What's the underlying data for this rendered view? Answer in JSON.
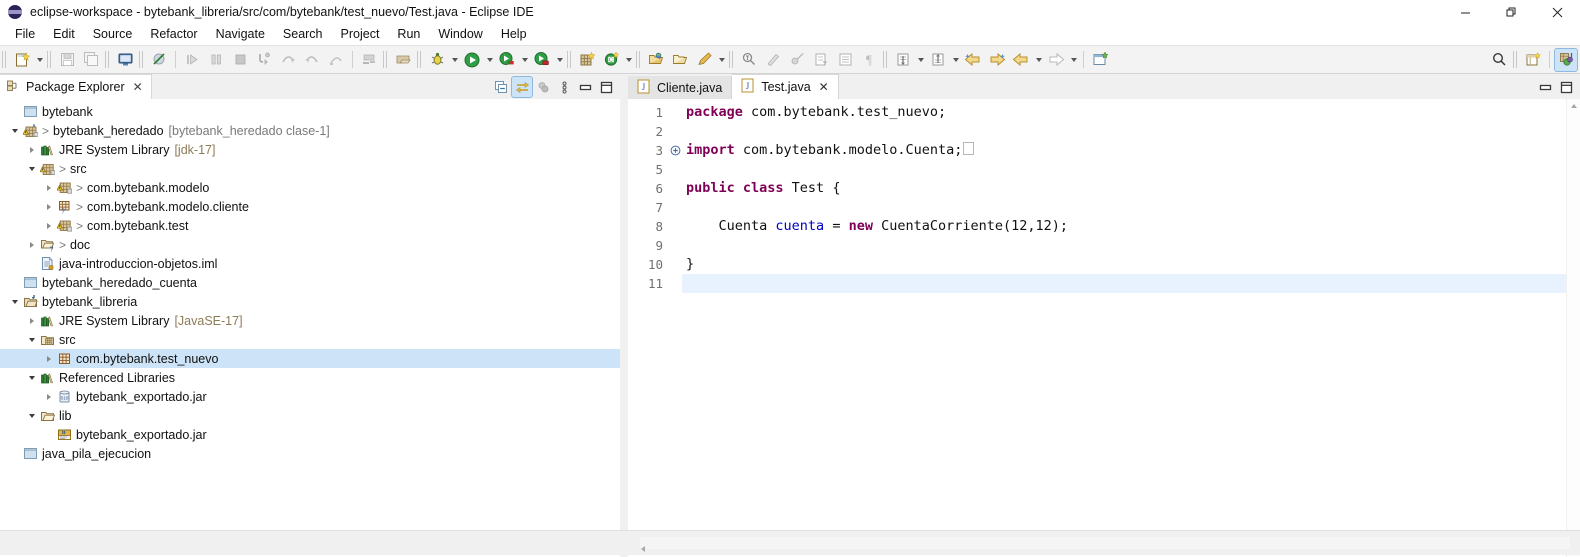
{
  "window": {
    "title": "eclipse-workspace - bytebank_libreria/src/com/bytebank/test_nuevo/Test.java - Eclipse IDE",
    "logo_icon": "eclipse-logo",
    "minimize": "—",
    "restore": "❐",
    "close": "✕"
  },
  "menu": {
    "items": [
      {
        "label": "File"
      },
      {
        "label": "Edit"
      },
      {
        "label": "Source"
      },
      {
        "label": "Refactor"
      },
      {
        "label": "Navigate"
      },
      {
        "label": "Search"
      },
      {
        "label": "Project"
      },
      {
        "label": "Run"
      },
      {
        "label": "Window"
      },
      {
        "label": "Help"
      }
    ]
  },
  "toolbar": {
    "items": [
      {
        "name": "new-wizard-icon",
        "enabled": true
      },
      {
        "name": "new-wizard-dropdown-icon",
        "enabled": true
      },
      {
        "name": "save-icon",
        "enabled": false
      },
      {
        "name": "save-all-icon",
        "enabled": false
      },
      {
        "name": "console-icon",
        "enabled": true
      },
      {
        "name": "skip-breakpoints-icon",
        "enabled": true
      },
      {
        "name": "resume-icon",
        "enabled": false
      },
      {
        "name": "suspend-icon",
        "enabled": false
      },
      {
        "name": "terminate-icon",
        "enabled": false
      },
      {
        "name": "step-into-icon",
        "enabled": false
      },
      {
        "name": "step-over-icon",
        "enabled": false
      },
      {
        "name": "step-return-icon",
        "enabled": false
      },
      {
        "name": "drop-to-frame-icon",
        "enabled": false
      },
      {
        "name": "open-task-icon",
        "enabled": true
      },
      {
        "name": "open-type-icon",
        "enabled": true
      },
      {
        "name": "debug-icon",
        "enabled": true
      },
      {
        "name": "run-icon",
        "enabled": true
      },
      {
        "name": "run-configurations-icon",
        "enabled": true
      },
      {
        "name": "coverage-icon",
        "enabled": true
      },
      {
        "name": "new-java-project-icon",
        "enabled": true
      },
      {
        "name": "new-java-class-icon",
        "enabled": true
      },
      {
        "name": "open-perspective-icon",
        "enabled": true
      },
      {
        "name": "search-folder-icon",
        "enabled": true
      },
      {
        "name": "annotation-icon",
        "enabled": true
      },
      {
        "name": "toggle-mark-occurrences-icon",
        "enabled": true
      },
      {
        "name": "pencil-icon",
        "enabled": false
      },
      {
        "name": "link-icon",
        "enabled": false
      },
      {
        "name": "show-whitespace-icon",
        "enabled": false
      },
      {
        "name": "block-selection-icon",
        "enabled": false
      },
      {
        "name": "paragraph-icon",
        "enabled": false
      },
      {
        "name": "previous-annotation-icon",
        "enabled": true
      },
      {
        "name": "next-annotation-icon",
        "enabled": true
      },
      {
        "name": "back-icon",
        "enabled": true
      },
      {
        "name": "forward-icon",
        "enabled": true
      },
      {
        "name": "last-edit-icon",
        "enabled": true
      },
      {
        "name": "next-edit-icon",
        "enabled": true
      },
      {
        "name": "new-window-icon",
        "enabled": true
      }
    ],
    "right_items": [
      {
        "name": "search-icon"
      },
      {
        "name": "open-perspective-button-icon"
      },
      {
        "name": "java-perspective-icon",
        "active": true
      }
    ]
  },
  "explorer": {
    "tab_label": "Package Explorer",
    "tab_icon": "package-explorer-icon",
    "tab_close": "✕",
    "tools": [
      {
        "name": "collapse-all-icon",
        "active": false
      },
      {
        "name": "link-with-editor-icon",
        "active": true
      },
      {
        "name": "focus-on-active-task-icon",
        "active": false
      },
      {
        "name": "view-menu-icon",
        "active": false
      },
      {
        "name": "minimize-view-icon",
        "active": false
      },
      {
        "name": "maximize-view-icon",
        "active": false
      }
    ],
    "tree": [
      {
        "depth": 0,
        "twisty": "none",
        "icon": "closed-project-icon",
        "chevron": false,
        "label": "bytebank",
        "suffix": ""
      },
      {
        "depth": 0,
        "twisty": "open",
        "icon": "java-project-warn-icon",
        "chevron": true,
        "label": "bytebank_heredado",
        "suffix": "[bytebank_heredado clase-1]"
      },
      {
        "depth": 1,
        "twisty": "close",
        "icon": "library-icon",
        "chevron": false,
        "label": "JRE System Library",
        "suffix": "[jdk-17]"
      },
      {
        "depth": 1,
        "twisty": "open",
        "icon": "source-folder-warn-icon",
        "chevron": true,
        "label": "src",
        "suffix": ""
      },
      {
        "depth": 2,
        "twisty": "close",
        "icon": "package-warn-icon",
        "chevron": true,
        "label": "com.bytebank.modelo",
        "suffix": ""
      },
      {
        "depth": 2,
        "twisty": "close",
        "icon": "package-question-icon",
        "chevron": true,
        "label": "com.bytebank.modelo.cliente",
        "suffix": ""
      },
      {
        "depth": 2,
        "twisty": "close",
        "icon": "package-warn-icon",
        "chevron": true,
        "label": "com.bytebank.test",
        "suffix": ""
      },
      {
        "depth": 1,
        "twisty": "close",
        "icon": "folder-question-icon",
        "chevron": true,
        "label": "doc",
        "suffix": ""
      },
      {
        "depth": 1,
        "twisty": "none",
        "icon": "file-icon",
        "chevron": false,
        "label": "java-introduccion-objetos.iml",
        "suffix": ""
      },
      {
        "depth": 0,
        "twisty": "none",
        "icon": "closed-project-icon",
        "chevron": false,
        "label": "bytebank_heredado_cuenta",
        "suffix": ""
      },
      {
        "depth": 0,
        "twisty": "open",
        "icon": "java-project-icon",
        "chevron": false,
        "label": "bytebank_libreria",
        "suffix": ""
      },
      {
        "depth": 1,
        "twisty": "close",
        "icon": "library-icon",
        "chevron": false,
        "label": "JRE System Library",
        "suffix": "[JavaSE-17]"
      },
      {
        "depth": 1,
        "twisty": "open",
        "icon": "source-folder-icon",
        "chevron": false,
        "label": "src",
        "suffix": ""
      },
      {
        "depth": 2,
        "twisty": "close",
        "icon": "package-icon",
        "chevron": false,
        "label": "com.bytebank.test_nuevo",
        "suffix": "",
        "selected": true
      },
      {
        "depth": 1,
        "twisty": "open",
        "icon": "library-icon",
        "chevron": false,
        "label": "Referenced Libraries",
        "suffix": ""
      },
      {
        "depth": 2,
        "twisty": "close",
        "icon": "jar-icon",
        "chevron": false,
        "label": "bytebank_exportado.jar",
        "suffix": ""
      },
      {
        "depth": 1,
        "twisty": "open",
        "icon": "folder-icon",
        "chevron": false,
        "label": "lib",
        "suffix": ""
      },
      {
        "depth": 2,
        "twisty": "none",
        "icon": "java-jar-icon",
        "chevron": false,
        "label": "bytebank_exportado.jar",
        "suffix": ""
      },
      {
        "depth": 0,
        "twisty": "none",
        "icon": "closed-project-icon",
        "chevron": false,
        "label": "java_pila_ejecucion",
        "suffix": ""
      }
    ]
  },
  "editor": {
    "tabs": [
      {
        "label": "Cliente.java",
        "icon": "java-file-icon",
        "active": false,
        "close": ""
      },
      {
        "label": "Test.java",
        "icon": "java-file-icon",
        "active": true,
        "close": "✕"
      }
    ],
    "tools": [
      {
        "name": "minimize-editor-icon"
      },
      {
        "name": "maximize-editor-icon"
      }
    ],
    "colors": {
      "keyword": "#7F0055",
      "variable": "#0000C0",
      "text": "#111111",
      "line_number": "#707070",
      "current_line": "#E8F2FE"
    },
    "lines": [
      {
        "num": "1",
        "fold": "",
        "current": false,
        "tokens": [
          {
            "t": "package",
            "c": "kw"
          },
          {
            "t": " com.bytebank.test_nuevo;",
            "c": "plain"
          }
        ]
      },
      {
        "num": "2",
        "fold": "",
        "current": false,
        "tokens": []
      },
      {
        "num": "3",
        "fold": "+",
        "current": false,
        "tokens": [
          {
            "t": "import",
            "c": "kw"
          },
          {
            "t": " com.bytebank.modelo.Cuenta;",
            "c": "plain"
          },
          {
            "t": "",
            "c": "foldbox"
          }
        ]
      },
      {
        "num": "5",
        "fold": "",
        "current": false,
        "tokens": []
      },
      {
        "num": "6",
        "fold": "",
        "current": false,
        "tokens": [
          {
            "t": "public class",
            "c": "kw"
          },
          {
            "t": " Test {",
            "c": "plain"
          }
        ]
      },
      {
        "num": "7",
        "fold": "",
        "current": false,
        "tokens": []
      },
      {
        "num": "8",
        "fold": "",
        "current": false,
        "tokens": [
          {
            "t": "    Cuenta ",
            "c": "plain"
          },
          {
            "t": "cuenta",
            "c": "var"
          },
          {
            "t": " = ",
            "c": "plain"
          },
          {
            "t": "new",
            "c": "kw"
          },
          {
            "t": " CuentaCorriente(12,12);",
            "c": "plain"
          }
        ]
      },
      {
        "num": "9",
        "fold": "",
        "current": false,
        "tokens": []
      },
      {
        "num": "10",
        "fold": "",
        "current": false,
        "tokens": [
          {
            "t": "}",
            "c": "plain"
          }
        ]
      },
      {
        "num": "11",
        "fold": "",
        "current": true,
        "tokens": []
      }
    ]
  }
}
